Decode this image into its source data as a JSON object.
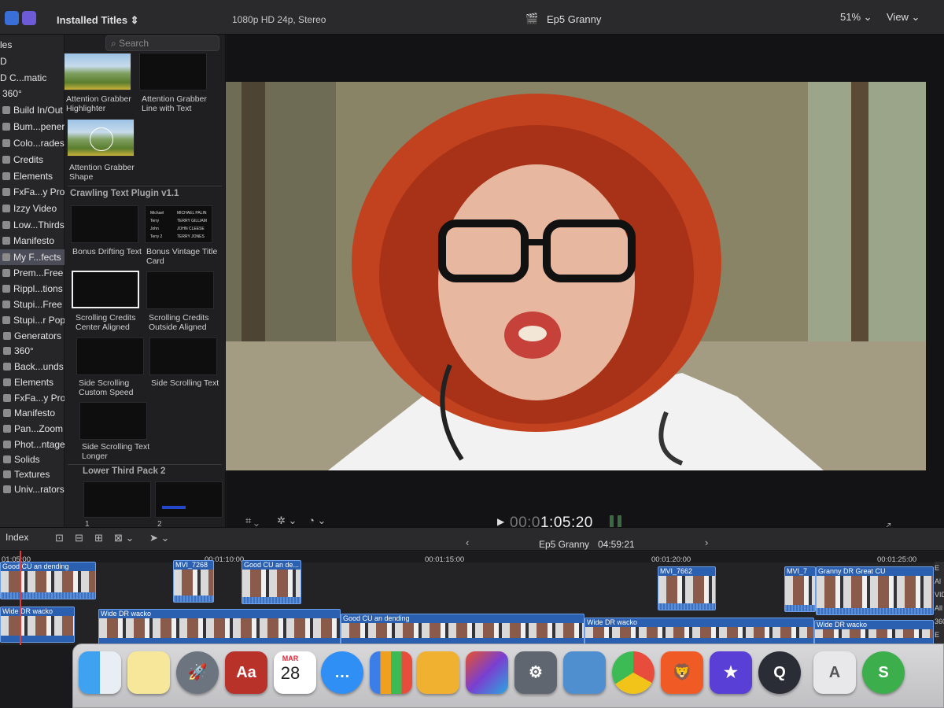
{
  "topbar": {
    "installed_label": "Installed Titles ⇕",
    "format": "1080p HD 24p, Stereo",
    "project": "Ep5 Granny",
    "zoom": "51% ⌄",
    "view": "View ⌄"
  },
  "sidebar": {
    "items": [
      {
        "label": "les"
      },
      {
        "label": "D"
      },
      {
        "label": "D C...matic"
      },
      {
        "label": "360°"
      },
      {
        "label": "Build In/Out"
      },
      {
        "label": "Bum...pener"
      },
      {
        "label": "Colo...rades"
      },
      {
        "label": "Credits"
      },
      {
        "label": "Elements"
      },
      {
        "label": "FxFa...y Pro"
      },
      {
        "label": "Izzy Video"
      },
      {
        "label": "Low...Thirds"
      },
      {
        "label": "Manifesto"
      },
      {
        "label": "My F...fects"
      },
      {
        "label": "Prem...Free"
      },
      {
        "label": "Rippl...tions"
      },
      {
        "label": "Stupi...Free"
      },
      {
        "label": "Stupi...r Pop"
      },
      {
        "label": "Generators"
      },
      {
        "label": "360°"
      },
      {
        "label": "Back...unds"
      },
      {
        "label": "Elements"
      },
      {
        "label": "FxFa...y Pro"
      },
      {
        "label": "Manifesto"
      },
      {
        "label": "Pan...Zoom"
      },
      {
        "label": "Phot...ntage"
      },
      {
        "label": "Solids"
      },
      {
        "label": "Textures"
      },
      {
        "label": "Univ...rators"
      }
    ]
  },
  "browser": {
    "search_placeholder": "Search",
    "categories": [
      "Crawling Text Plugin v1.1",
      "Lower Third Pack 2"
    ],
    "titles": [
      {
        "label": "Attention Grabber Highlighter"
      },
      {
        "label": "Attention Grabber Line with Text"
      },
      {
        "label": "Attention Grabber Shape"
      },
      {
        "label": "Bonus Drifting Text"
      },
      {
        "label": "Bonus Vintage Title Card"
      },
      {
        "label": "Scrolling Credits Center Aligned"
      },
      {
        "label": "Scrolling Credits Outside Aligned"
      },
      {
        "label": "Side Scrolling Custom Speed"
      },
      {
        "label": "Side Scrolling Text"
      },
      {
        "label": "Side Scrolling Text Longer"
      }
    ],
    "credits_card": {
      "names": [
        "Michael",
        "Terry",
        "John",
        "Terry 2"
      ],
      "roles": [
        "MICHAEL PALIN",
        "TERRY GILLIAM",
        "JOHN CLEESE",
        "TERRY JONES"
      ]
    },
    "lower_third_numbers": [
      "1",
      "2"
    ]
  },
  "viewer": {
    "timecode_dim": "00:0",
    "timecode": "1:05:20",
    "play_icon": "▶"
  },
  "timeline": {
    "index_label": "Index",
    "project": "Ep5 Granny",
    "duration": "04:59:21",
    "ruler": [
      "01:05:00",
      "00:01:10:00",
      "00:01:15:00",
      "00:01:20:00",
      "00:01:25:00"
    ],
    "clips": [
      {
        "title": "Good CU an dending"
      },
      {
        "title": "MVI_7268"
      },
      {
        "title": "Good CU an de..."
      },
      {
        "title": "MVI_7662"
      },
      {
        "title": "MVI_7"
      },
      {
        "title": "Granny DR Great CU"
      },
      {
        "title": "Wide DR wacko"
      },
      {
        "title": "Wide DR wacko"
      },
      {
        "title": "Good CU an dending"
      },
      {
        "title": "Wide DR wacko"
      },
      {
        "title": "Wide DR wacko"
      }
    ],
    "right_edge_labels": [
      "E",
      "Al",
      "VID",
      "All",
      "360",
      "E"
    ]
  },
  "dock": {
    "dictionary_label": "Dictionary",
    "dictionary_glyph": "Aa",
    "calendar_month": "MAR",
    "calendar_day": "28"
  },
  "colors": {
    "accent": "#2b5fb0",
    "playhead": "#e23b3b",
    "selection": "#4a4d57"
  }
}
